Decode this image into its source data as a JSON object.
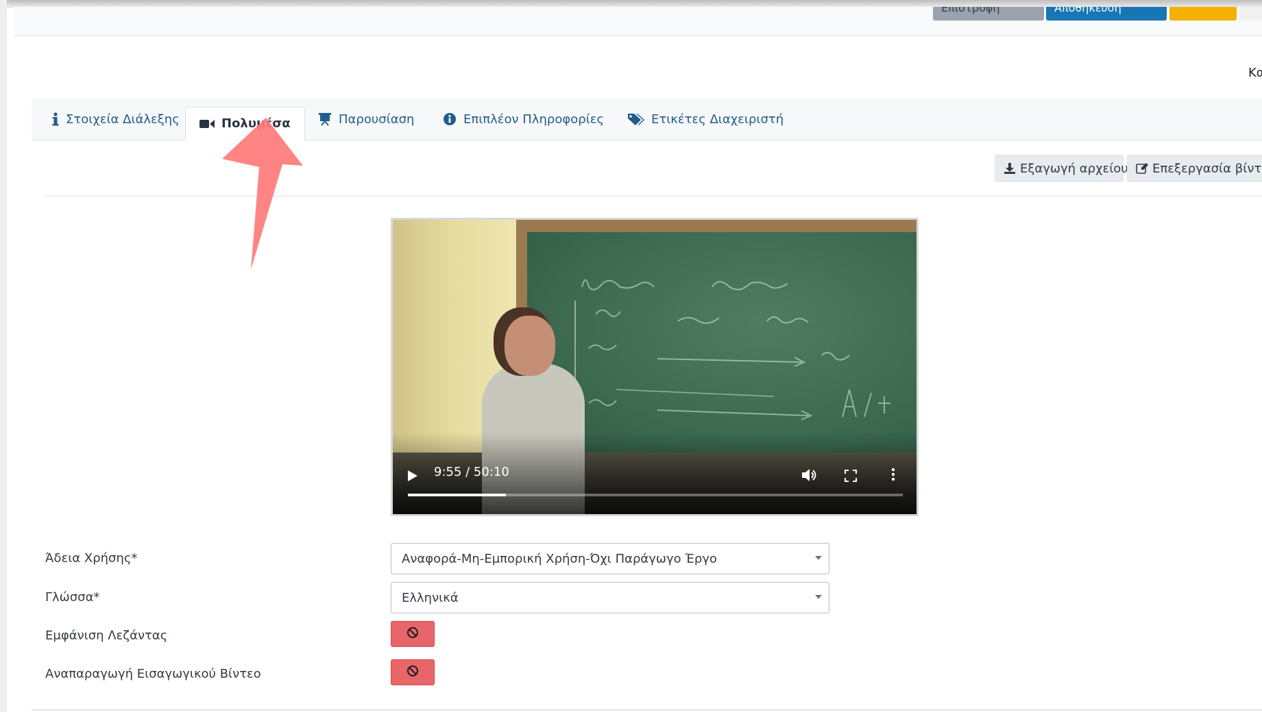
{
  "topbar": {
    "buttons": [
      {
        "label": "Επιστροφή",
        "color": "#9aa3ad"
      },
      {
        "label": "Αποθήκευση",
        "color": "#1976b5"
      },
      {
        "label": "",
        "color": "#f4b000"
      },
      {
        "label": "",
        "color": "#f0f0f0"
      }
    ]
  },
  "corner_label": "Κατ",
  "tabs": [
    {
      "label": "Στοιχεία Διάλεξης",
      "icon": "info-icon"
    },
    {
      "label": "Πολυμέσα",
      "icon": "video-camera-icon",
      "active": true
    },
    {
      "label": "Παρουσίαση",
      "icon": "presentation-icon"
    },
    {
      "label": "Επιπλέον Πληροφορίες",
      "icon": "info-circle-icon"
    },
    {
      "label": "Ετικέτες Διαχειριστή",
      "icon": "tags-icon"
    }
  ],
  "actions": {
    "export_label": "Εξαγωγή αρχείου",
    "edit_label": "Επεξεργασία βίντεο"
  },
  "video": {
    "current_time": "9:55",
    "duration": "50:10",
    "time_display": "9:55 / 50:10",
    "progress": 0.198
  },
  "form": {
    "license_label": "Άδεια Χρήσης*",
    "license_value": "Αναφορά-Μη-Εμπορική Χρήση-Όχι Παράγωγο Έργο",
    "language_label": "Γλώσσα*",
    "language_value": "Ελληνικά",
    "captions_label": "Εμφάνιση Λεζάντας",
    "intro_label": "Αναπαραγωγή Εισαγωγικού Βίντεο"
  },
  "colors": {
    "tab_text": "#1f5d8c",
    "toggle_off": "#e8656a",
    "annotation_arrow": "#ff7b7b"
  }
}
